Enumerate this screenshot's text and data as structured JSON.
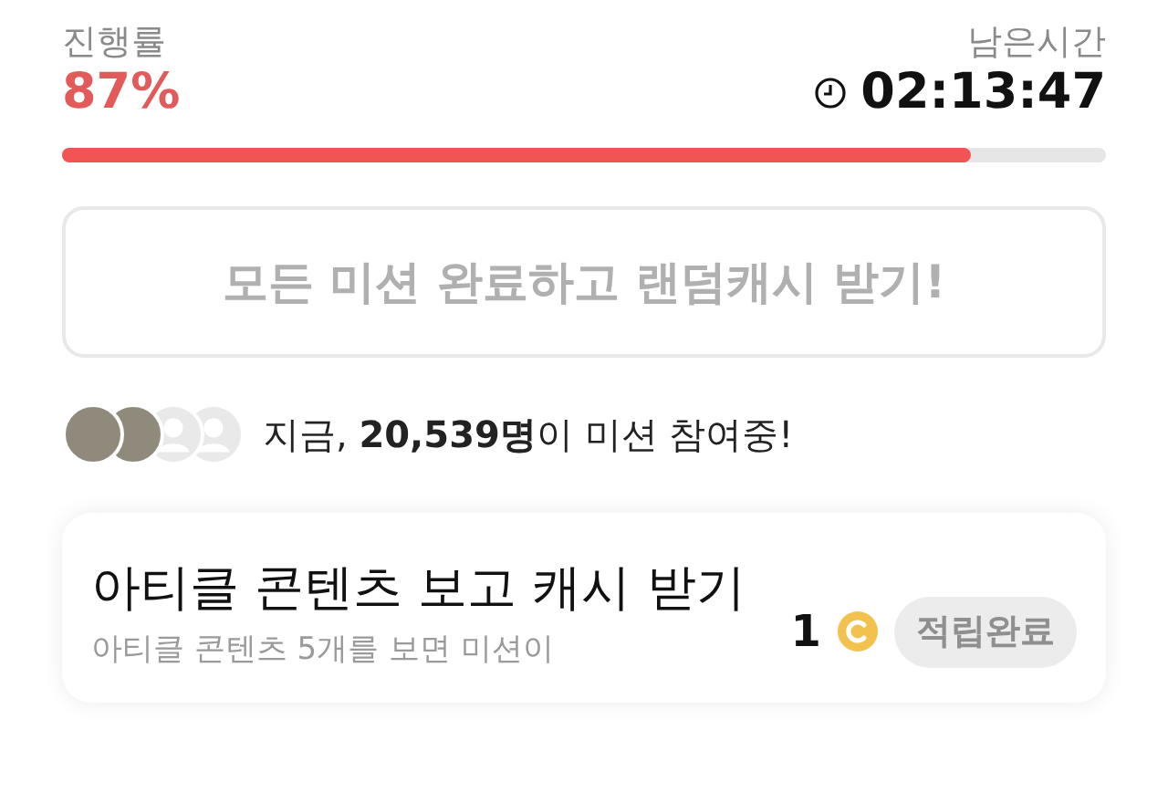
{
  "progress": {
    "label": "진행률",
    "value": "87%",
    "level": 0.87
  },
  "timer": {
    "label": "남은시간",
    "value": "02:13:47"
  },
  "complete_button": {
    "label": "모든 미션 완료하고 랜덤캐시 받기!",
    "disabled": true
  },
  "participants": {
    "avatars": [
      {
        "kind": "photo"
      },
      {
        "kind": "photo"
      },
      {
        "kind": "placeholder"
      },
      {
        "kind": "placeholder"
      }
    ],
    "text": "지금, **20,539명**이 미션 참여중!"
  },
  "missions": [
    {
      "title": "아티클 콘텐츠 보고 캐시 받기",
      "description": "아티클 콘텐츠 5개를 보면 미션이",
      "reward": "1",
      "button": "적립완료",
      "done": true
    }
  ]
}
